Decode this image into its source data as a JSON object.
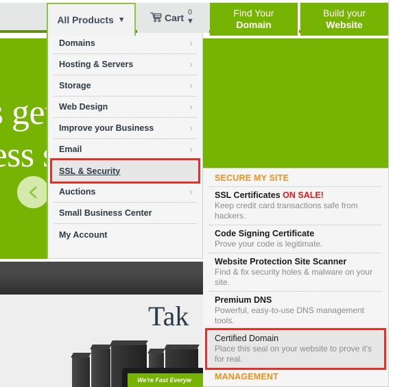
{
  "nav": {
    "all_products": {
      "label": "All Products",
      "caret": "▼"
    },
    "cart": {
      "label": "Cart",
      "count": "0",
      "caret": "▼",
      "icon": "shopping-cart-icon"
    },
    "find_domain": {
      "line1": "Find Your",
      "line2": "Domain"
    },
    "build_website": {
      "line1": "Build your",
      "line2": "Website"
    }
  },
  "hero": {
    "headline_line1": "t's get your",
    "headline_line2": "ness starte",
    "prev_arrow": "chevron-left-icon"
  },
  "lower": {
    "heading": "Tak",
    "banner": "We're Fast Everyw"
  },
  "dropdown": {
    "items": [
      {
        "label": "Domains",
        "chevron": "›",
        "highlighted": false
      },
      {
        "label": "Hosting & Servers",
        "chevron": "›",
        "highlighted": false
      },
      {
        "label": "Storage",
        "chevron": "›",
        "highlighted": false
      },
      {
        "label": "Web Design",
        "chevron": "›",
        "highlighted": false
      },
      {
        "label": "Improve your Business",
        "chevron": "›",
        "highlighted": false
      },
      {
        "label": "Email",
        "chevron": "›",
        "highlighted": false
      },
      {
        "label": "SSL & Security",
        "chevron": "",
        "highlighted": true
      },
      {
        "label": "Auctions",
        "chevron": "›",
        "highlighted": false
      },
      {
        "label": "Small Business Center",
        "chevron": "",
        "highlighted": false
      },
      {
        "label": "My Account",
        "chevron": "",
        "highlighted": false
      }
    ]
  },
  "submenu": {
    "section1_title": "SECURE MY SITE",
    "items": [
      {
        "title": "SSL Certificates",
        "badge": "ON SALE!",
        "desc": "Keep credit card transactions safe from hackers.",
        "highlighted": false
      },
      {
        "title": "Code Signing Certificate",
        "badge": "",
        "desc": "Prove your code is legitimate.",
        "highlighted": false
      },
      {
        "title": "Website Protection Site Scanner",
        "badge": "",
        "desc": "Find & fix security holes & malware on your site.",
        "highlighted": false
      },
      {
        "title": "Premium DNS",
        "badge": "",
        "desc": "Powerful, easy-to-use DNS management tools.",
        "highlighted": false
      },
      {
        "title": "Certified Domain",
        "badge": "",
        "desc": "Place this seal on your website to prove it's for real.",
        "highlighted": true
      }
    ],
    "section2_title": "MANAGEMENT"
  },
  "colors": {
    "brand_green": "#76b302",
    "accent_green": "#8cc63e",
    "orange": "#f0901d",
    "sale_red": "#e01b1b",
    "highlight_red": "#ee2a2a"
  }
}
